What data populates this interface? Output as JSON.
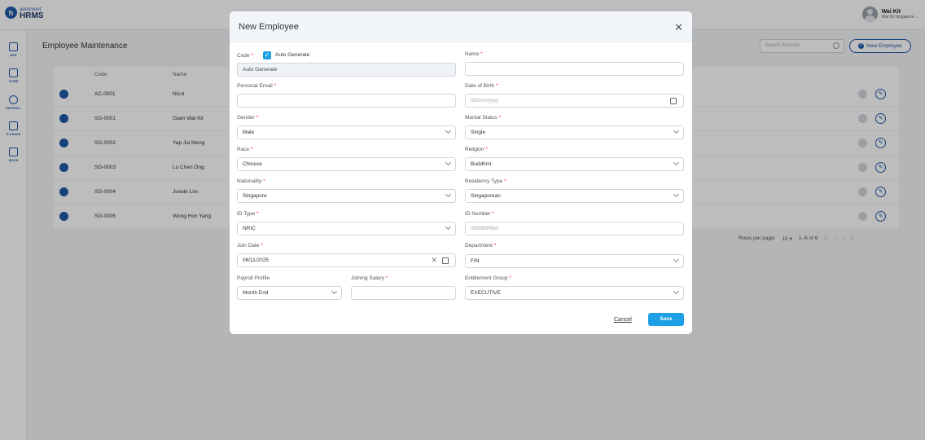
{
  "app": {
    "logo_top": "autocount",
    "logo_bottom": "HRMS",
    "logo_mark": "h"
  },
  "user": {
    "name": "Wai Kit",
    "company": "Wai Kit Singapore ⌄"
  },
  "sidenav": [
    {
      "label": "ESS",
      "icon": "home-icon"
    },
    {
      "label": "CORE",
      "icon": "cube-icon"
    },
    {
      "label": "PAYROLL",
      "icon": "coin-icon"
    },
    {
      "label": "E-LEAVE",
      "icon": "calendar-icon"
    },
    {
      "label": "DOCS",
      "icon": "document-icon"
    }
  ],
  "page": {
    "title": "Employee Maintenance",
    "search_placeholder": "Search Records",
    "new_employee_label": "New Employee"
  },
  "table": {
    "headers": {
      "code": "Code",
      "name": "Name"
    },
    "rows": [
      {
        "code": "AC-0001",
        "name": "Nicol"
      },
      {
        "code": "SG-0001",
        "name": "Giam Wai Kit"
      },
      {
        "code": "SG-0002",
        "name": "Yap Jui Meng"
      },
      {
        "code": "SG-0003",
        "name": "Lu Chen Ong"
      },
      {
        "code": "SG-0004",
        "name": "Josele Lim"
      },
      {
        "code": "SG-0005",
        "name": "Wong Hon Yang"
      }
    ],
    "pager": {
      "rows_label": "Rows per page:",
      "rows_value": "10 ▾",
      "range": "1–6 of 6",
      "first": "|‹",
      "prev": "‹",
      "next": "›",
      "last": "›|"
    }
  },
  "modal": {
    "title": "New Employee",
    "close": "✕",
    "fields": {
      "code": {
        "label": "Code",
        "value": "Auto Generate",
        "checkbox_label": "Auto Generate",
        "checked": true
      },
      "name": {
        "label": "Name",
        "value": ""
      },
      "personal_email": {
        "label": "Personal Email",
        "value": ""
      },
      "date_of_birth": {
        "label": "Date of Birth",
        "placeholder": "dd/mm/yyyy"
      },
      "gender": {
        "label": "Gender",
        "value": "Male"
      },
      "marital_status": {
        "label": "Marital Status",
        "value": "Single"
      },
      "race": {
        "label": "Race",
        "value": "Chinese"
      },
      "religion": {
        "label": "Religion",
        "value": "Buddhist"
      },
      "nationality": {
        "label": "Nationality",
        "value": "Singapore"
      },
      "residency_type": {
        "label": "Residency Type",
        "value": "Singaporean"
      },
      "id_type": {
        "label": "ID Type",
        "value": "NRIC"
      },
      "id_number": {
        "label": "ID Number",
        "placeholder": "S9999999A"
      },
      "join_date": {
        "label": "Join Date",
        "value": "06/11/2025"
      },
      "department": {
        "label": "Department",
        "value": "FIN"
      },
      "payroll_profile": {
        "label": "Payroll Profile",
        "value": "Month End"
      },
      "joining_salary": {
        "label": "Joining Salary",
        "value": ""
      },
      "entitlement_group": {
        "label": "Entitlement Group",
        "value": "EXECUTIVE"
      }
    },
    "required_mark": "*",
    "cancel_label": "Cancel",
    "save_label": "Save"
  }
}
